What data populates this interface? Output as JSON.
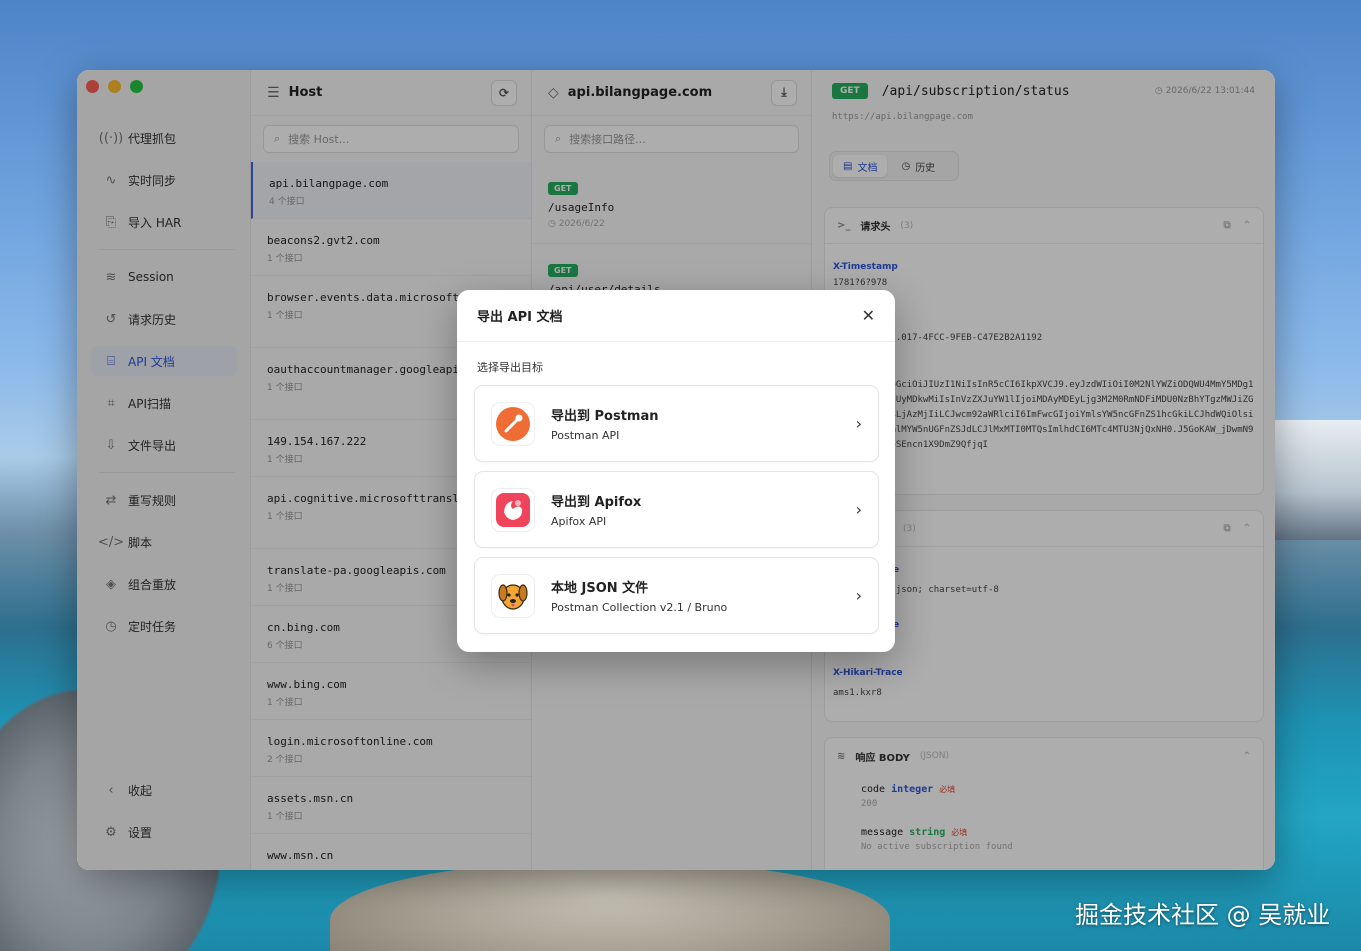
{
  "window": {
    "traffic_lights": [
      "#ff5f57",
      "#febc2e",
      "#28c840"
    ]
  },
  "sidebar": {
    "items": [
      {
        "label": "代理抓包",
        "icon": "radio-waves-icon"
      },
      {
        "label": "实时同步",
        "icon": "activity-icon"
      },
      {
        "label": "导入 HAR",
        "icon": "file-import-icon"
      },
      {
        "label": "Session",
        "icon": "database-icon"
      },
      {
        "label": "请求历史",
        "icon": "history-icon"
      },
      {
        "label": "API 文档",
        "icon": "book-icon",
        "active": true
      },
      {
        "label": "API扫描",
        "icon": "scan-icon"
      },
      {
        "label": "文件导出",
        "icon": "export-icon"
      },
      {
        "label": "重写规则",
        "icon": "rewrite-icon"
      },
      {
        "label": "脚本",
        "icon": "code-icon"
      },
      {
        "label": "组合重放",
        "icon": "layers-icon"
      },
      {
        "label": "定时任务",
        "icon": "alarm-icon"
      }
    ],
    "collapse_label": "收起",
    "settings_label": "设置"
  },
  "host_panel": {
    "title": "Host",
    "search_placeholder": "搜索 Host...",
    "hosts": [
      {
        "name": "api.bilangpage.com",
        "count": "4 个接口",
        "selected": true
      },
      {
        "name": "beacons2.gvt2.com",
        "count": "1 个接口"
      },
      {
        "name": "browser.events.data.microsoft.com",
        "count": "1 个接口"
      },
      {
        "name": "oauthaccountmanager.googleapis.com",
        "count": "1 个接口"
      },
      {
        "name": "149.154.167.222",
        "count": "1 个接口"
      },
      {
        "name": "api.cognitive.microsofttranslator.com",
        "count": "1 个接口"
      },
      {
        "name": "translate-pa.googleapis.com",
        "count": "1 个接口"
      },
      {
        "name": "cn.bing.com",
        "count": "6 个接口"
      },
      {
        "name": "www.bing.com",
        "count": "1 个接口"
      },
      {
        "name": "login.microsoftonline.com",
        "count": "2 个接口"
      },
      {
        "name": "assets.msn.cn",
        "count": "1 个接口"
      },
      {
        "name": "www.msn.cn",
        "count": ""
      }
    ]
  },
  "endpoint_panel": {
    "title": "api.bilangpage.com",
    "search_placeholder": "搜索接口路径...",
    "endpoints": [
      {
        "method": "GET",
        "path": "/usageInfo",
        "date": "2026/6/22"
      },
      {
        "method": "GET",
        "path": "/api/user/details",
        "date": ""
      }
    ]
  },
  "detail": {
    "method": "GET",
    "path": "/api/subscription/status",
    "time": "2026/6/22 13:01:44",
    "url": "https://api.bilangpage.com",
    "tabs": [
      "文档",
      "历史"
    ],
    "headers_title": "请求头",
    "headers_count": "(3)",
    "headers": [
      {
        "key": "X-Timestamp",
        "value": "1781?6?978"
      },
      {
        "key": "",
        "value": "...017-4FCC-9FEB-C47E2B2A1192"
      },
      {
        "key": "",
        "value": "hbGciOiJIUzI1NiIsInR5cCI6IkpXVCJ9.eyJzdWIiOiI0M2NlYWZiODQWU4MmY5MDg1MzUyMDkwMiIsInVzZXJuYW1lIjoiMDAyMDEyLjg3M2M0RmNDFiMDU0NzBhYTgzMWJiZGU4LjAzMjIiLCJwcm92aWRlciI6ImFwcGIjoiYmlsYW5ncGFnZS1hcGkiLCJhdWQiOlsiQmlMYW5nUGFnZSJdLCJlMxMTI0MTQsImlhdCI6MTc4MTU3NjQxNH0.J5GoKAW_jDwmN9vpSEncn1X9DmZ9QfjqI"
      }
    ],
    "resp_headers_count": "(3)",
    "resp_headers": [
      {
        "key": "e",
        "value": "n/json; charset=utf-8"
      },
      {
        "key": "e",
        "value": ""
      },
      {
        "key": "X-Hikari-Trace",
        "value": "ams1.kxr8"
      }
    ],
    "body_title": "响应 BODY",
    "body_type": "(JSON)",
    "fields": [
      {
        "name": "code",
        "type": "integer",
        "required": "必填",
        "example": "200"
      },
      {
        "name": "message",
        "type": "string",
        "required": "必填",
        "example": "No active subscription found"
      }
    ]
  },
  "modal": {
    "title": "导出 API 文档",
    "subtitle": "选择导出目标",
    "options": [
      {
        "title": "导出到 Postman",
        "subtitle": "Postman API",
        "icon": "postman-icon",
        "color": "#ef6c34"
      },
      {
        "title": "导出到 Apifox",
        "subtitle": "Apifox API",
        "icon": "apifox-icon",
        "color": "#f0445a"
      },
      {
        "title": "本地 JSON 文件",
        "subtitle": "Postman Collection v2.1 / Bruno",
        "icon": "bruno-dog-icon",
        "color": "#f3a631"
      }
    ]
  },
  "watermark": "掘金技术社区 @ 吴就业"
}
